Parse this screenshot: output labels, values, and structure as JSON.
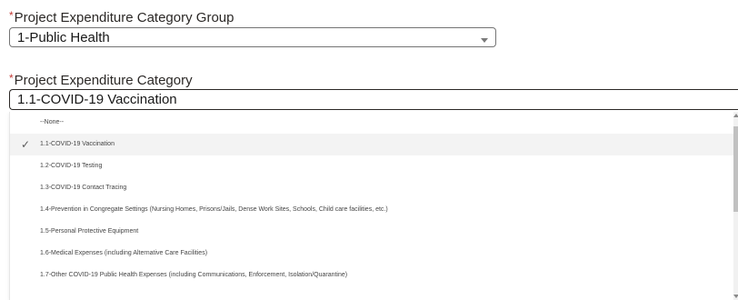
{
  "form": {
    "group_field": {
      "required_marker": "*",
      "label": "Project Expenditure Category Group",
      "value": "1-Public Health",
      "icon": "chevron-down-icon"
    },
    "category_field": {
      "required_marker": "*",
      "label": "Project Expenditure Category",
      "value": "1.1-COVID-19 Vaccination",
      "icon": "chevron-down-icon"
    }
  },
  "dropdown": {
    "check_icon": "check-icon",
    "check_glyph": "✓",
    "options": [
      {
        "label": "--None--"
      },
      {
        "label": "1.1-COVID-19 Vaccination"
      },
      {
        "label": "1.2-COVID-19 Testing"
      },
      {
        "label": "1.3-COVID-19 Contact Tracing"
      },
      {
        "label": "1.4-Prevention in Congregate Settings (Nursing Homes, Prisons/Jails, Dense Work Sites, Schools, Child care facilities, etc.)"
      },
      {
        "label": "1.5-Personal Protective Equipment"
      },
      {
        "label": "1.6-Medical Expenses (including Alternative Care Facilities)"
      },
      {
        "label": "1.7-Other COVID-19 Public Health Expenses (including Communications, Enforcement, Isolation/Quarantine)"
      }
    ],
    "selected_index": 1
  },
  "colors": {
    "required": "#c23934",
    "selected_row": "#f3f3f3",
    "border": "#747474"
  }
}
